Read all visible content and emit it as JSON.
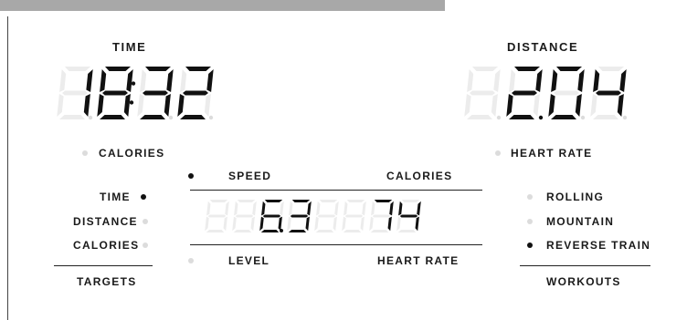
{
  "time": {
    "label": "TIME",
    "value": "18:32"
  },
  "distance": {
    "label": "DISTANCE",
    "value": "2.04"
  },
  "left_modes": {
    "calories_label": "CALORIES"
  },
  "right_modes": {
    "heart_rate_label": "HEART RATE"
  },
  "center": {
    "speed_label": "SPEED",
    "calories_label": "CALORIES",
    "level_label": "LEVEL",
    "heart_rate_label": "HEART RATE",
    "speed_value": "6.3",
    "calories_value": "74"
  },
  "targets": {
    "title": "TARGETS",
    "items": [
      {
        "label": "TIME",
        "active": true
      },
      {
        "label": "DISTANCE",
        "active": false
      },
      {
        "label": "CALORIES",
        "active": false
      }
    ]
  },
  "workouts": {
    "title": "WORKOUTS",
    "items": [
      {
        "label": "ROLLING",
        "active": false
      },
      {
        "label": "MOUNTAIN",
        "active": false
      },
      {
        "label": "REVERSE TRAIN",
        "active": true
      }
    ]
  },
  "colors": {
    "segment_on": "#111111",
    "segment_off": "#ececec",
    "indicator_off": "#dcdcdc",
    "top_bar": "#a8a8a8"
  }
}
